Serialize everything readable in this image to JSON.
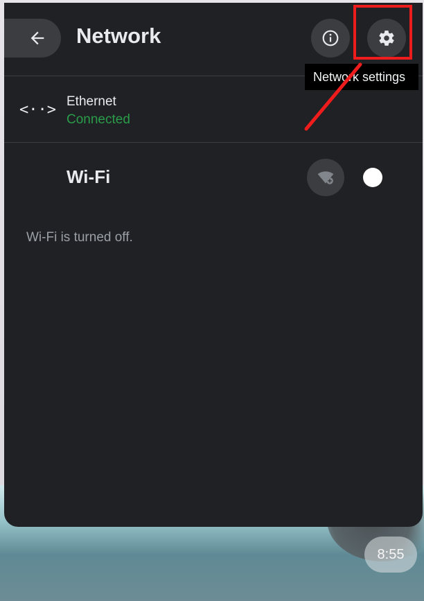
{
  "header": {
    "title": "Network",
    "back_icon": "arrow-left-icon",
    "info_icon": "info-icon",
    "settings_icon": "gear-icon"
  },
  "tooltip": {
    "text": "Network settings"
  },
  "ethernet": {
    "icon": "ethernet-icon",
    "icon_glyph": "<··>",
    "name": "Ethernet",
    "status": "Connected",
    "status_color": "#2a9d4a"
  },
  "wifi": {
    "label": "Wi-Fi",
    "add_icon": "wifi-add-icon",
    "toggle_on": false,
    "off_message": "Wi-Fi is turned off."
  },
  "shelf": {
    "time": "8:55"
  },
  "colors": {
    "panel_bg": "#202124",
    "button_bg": "#3c3d40",
    "highlight": "#ee1c1c"
  }
}
